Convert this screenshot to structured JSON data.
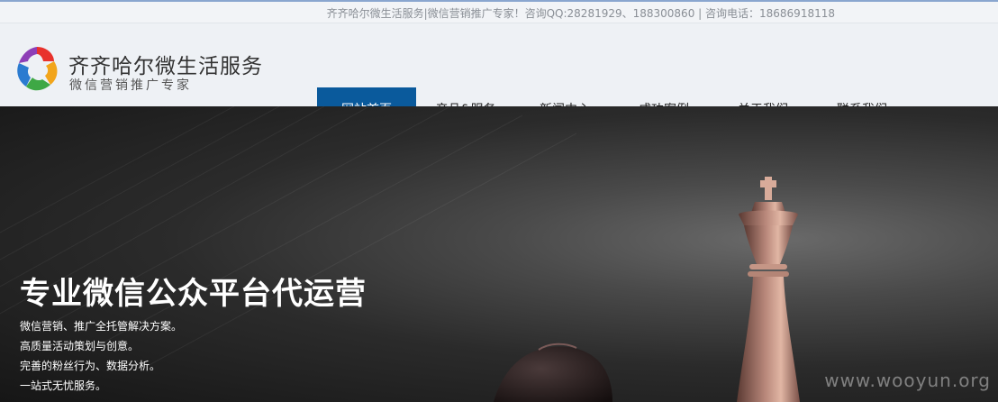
{
  "topbar": {
    "text": "齐齐哈尔微生活服务|微信营销推广专家！咨询QQ:28281929、188300860 | 咨询电话：18686918118"
  },
  "brand": {
    "name": "齐齐哈尔微生活服务",
    "tagline": "微信营销推广专家"
  },
  "nav": {
    "items": [
      "网站首页",
      "产品&服务",
      "新闻中心",
      "成功案例",
      "关于我们",
      "联系我们"
    ],
    "active": "网站首页"
  },
  "hero": {
    "title": "专业微信公众平台代运营",
    "lines": [
      "微信营销、推广全托管解决方案。",
      "高质量活动策划与创意。",
      "完善的粉丝行为、数据分析。",
      "一站式无忧服务。"
    ]
  },
  "watermark": "www.wooyun.org",
  "colors": {
    "nav_active": "#0a5a9c",
    "header_bg": "#eef1f5"
  }
}
